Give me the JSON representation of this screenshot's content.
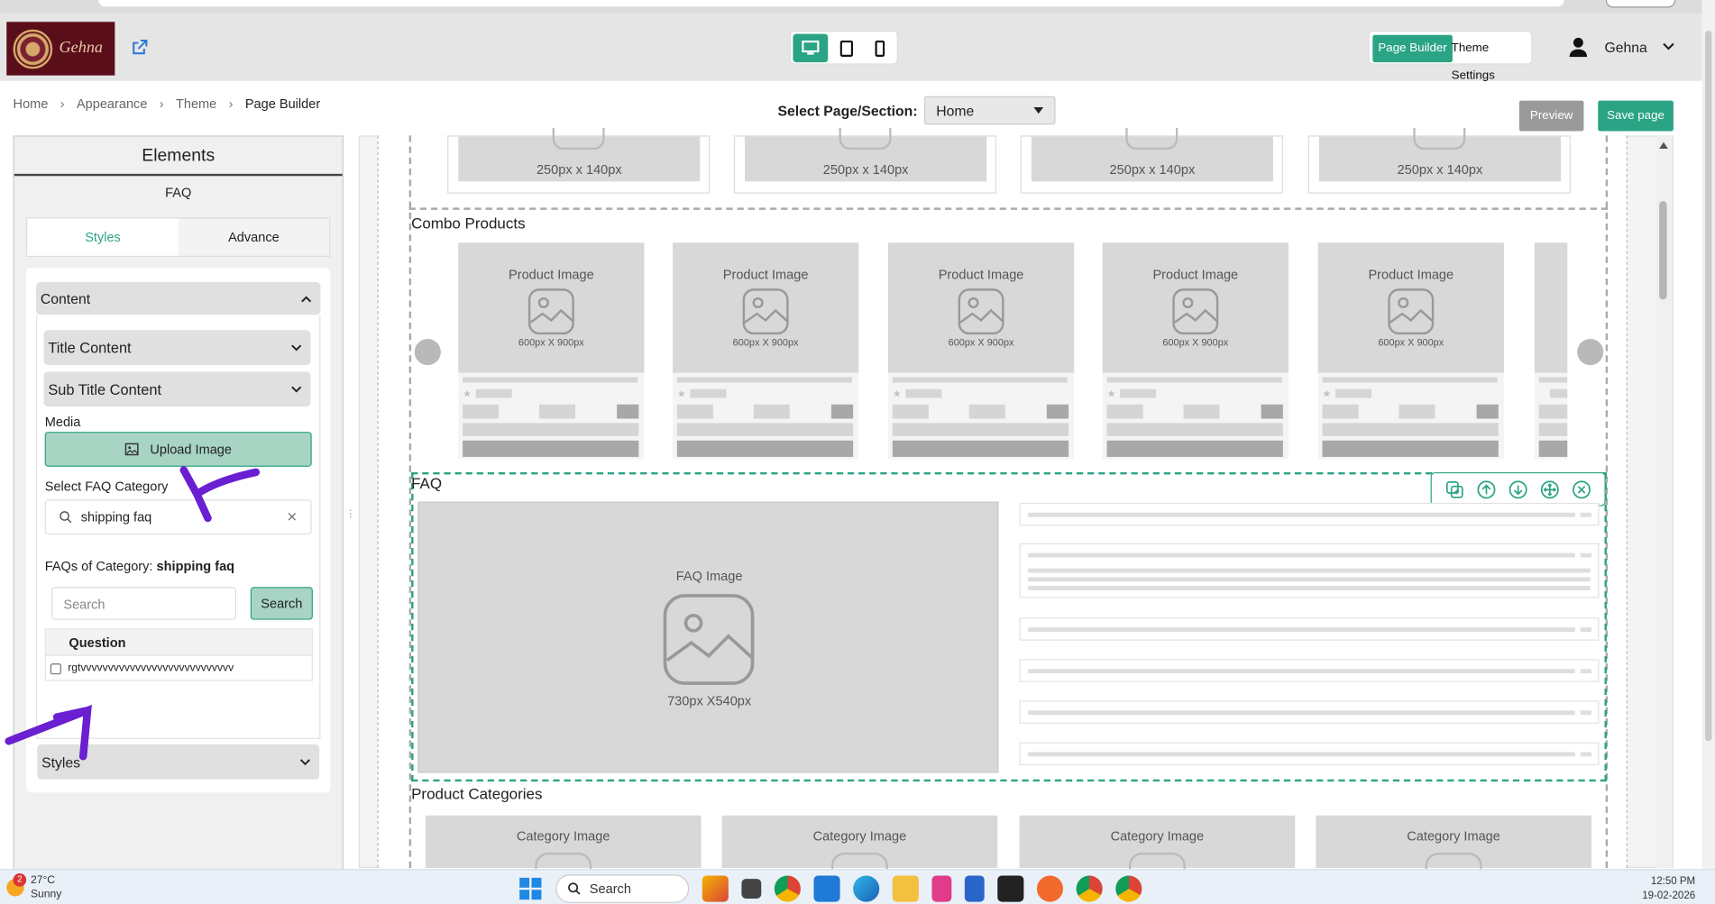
{
  "header": {
    "logo_text": "Gehna",
    "user_name": "Gehna",
    "page_builder_label": "Page Builder",
    "theme_settings_label": "Theme Settings"
  },
  "breadcrumb": [
    "Home",
    "Appearance",
    "Theme",
    "Page Builder"
  ],
  "page_select": {
    "label": "Select Page/Section:",
    "value": "Home"
  },
  "actions": {
    "preview": "Preview",
    "save": "Save page"
  },
  "sidebar": {
    "title": "Elements",
    "subtitle": "FAQ",
    "tabs": [
      "Styles",
      "Advance"
    ],
    "content_label": "Content",
    "title_content": "Title Content",
    "sub_title_content": "Sub Title Content",
    "media_label": "Media",
    "upload_label": "Upload Image",
    "faq_category_label": "Select FAQ Category",
    "faq_category_value": "shipping faq",
    "faqs_of_category_prefix": "FAQs of Category:",
    "faqs_of_category_value": "shipping faq",
    "search_placeholder": "Search",
    "search_button": "Search",
    "table_header": "Question",
    "questions": [
      "rgtvvvvvvvvvvvvvvvvvvvvvvvvvvvv"
    ],
    "styles_label": "Styles"
  },
  "canvas": {
    "top_banner_sizes": [
      "250px x 140px",
      "250px x 140px",
      "250px x 140px",
      "250px x 140px"
    ],
    "combo_title": "Combo Products",
    "product_image_label": "Product Image",
    "product_image_size": "600px X 900px",
    "faq_title": "FAQ",
    "faq_image_label": "FAQ Image",
    "faq_image_size": "730px X540px",
    "categories_title": "Product Categories",
    "category_image_label": "Category Image"
  },
  "taskbar": {
    "temperature": "27°C",
    "weather": "Sunny",
    "weather_badge": "2",
    "search_label": "Search",
    "time": "12:50 PM",
    "date": "19-02-2026"
  },
  "colors": {
    "accent": "#2aa484",
    "annotation": "#6a1fd1",
    "logo_bg": "#5a0e1a"
  }
}
